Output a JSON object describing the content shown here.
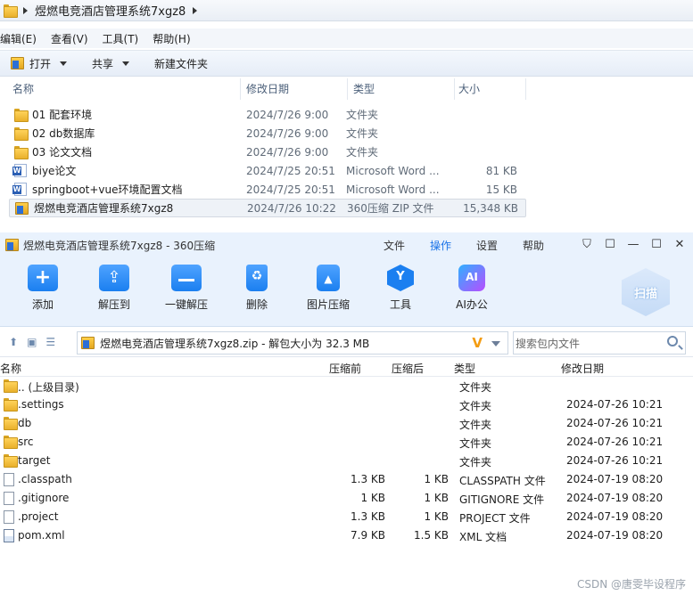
{
  "explorer": {
    "breadcrumb": "煜燃电竞酒店管理系统7xgz8",
    "menus": [
      "编辑(E)",
      "查看(V)",
      "工具(T)",
      "帮助(H)"
    ],
    "commands": {
      "open": "打开",
      "share": "共享",
      "new_folder": "新建文件夹"
    },
    "columns": {
      "name": "名称",
      "date": "修改日期",
      "type": "类型",
      "size": "大小"
    },
    "rows": [
      {
        "name": "01 配套环境",
        "date": "2024/7/26 9:00",
        "type": "文件夹",
        "size": "",
        "icon": "folder-icon"
      },
      {
        "name": "02 db数据库",
        "date": "2024/7/26 9:00",
        "type": "文件夹",
        "size": "",
        "icon": "folder-icon"
      },
      {
        "name": "03 论文文档",
        "date": "2024/7/26 9:00",
        "type": "文件夹",
        "size": "",
        "icon": "folder-icon"
      },
      {
        "name": "biye论文",
        "date": "2024/7/25 20:51",
        "type": "Microsoft Word ...",
        "size": "81 KB",
        "icon": "word-icon"
      },
      {
        "name": "springboot+vue环境配置文档",
        "date": "2024/7/25 20:51",
        "type": "Microsoft Word ...",
        "size": "15 KB",
        "icon": "word-icon"
      },
      {
        "name": "煜燃电竞酒店管理系统7xgz8",
        "date": "2024/7/26 10:22",
        "type": "360压缩 ZIP 文件",
        "size": "15,348 KB",
        "icon": "zip-icon"
      }
    ]
  },
  "zip": {
    "title": "煜燃电竞酒店管理系统7xgz8 - 360压缩",
    "menus": [
      {
        "label": "文件"
      },
      {
        "label": "操作",
        "active": true
      },
      {
        "label": "设置"
      },
      {
        "label": "帮助"
      }
    ],
    "tools": {
      "add": "添加",
      "extract_to": "解压到",
      "one_click": "一键解压",
      "delete": "删除",
      "image_compress": "图片压缩",
      "tools": "工具",
      "ai_office": "AI办公",
      "scan": "扫描"
    },
    "path": "煜燃电竞酒店管理系统7xgz8.zip - 解包大小为 32.3 MB",
    "search_placeholder": "搜索包内文件",
    "columns": {
      "name": "名称",
      "before": "压缩前",
      "after": "压缩后",
      "type": "类型",
      "date": "修改日期"
    },
    "rows": [
      {
        "name": ".. (上级目录)",
        "before": "",
        "after": "",
        "type": "文件夹",
        "date": "",
        "icon": "folder-icon"
      },
      {
        "name": ".settings",
        "before": "",
        "after": "",
        "type": "文件夹",
        "date": "2024-07-26 10:21",
        "icon": "folder-icon"
      },
      {
        "name": "db",
        "before": "",
        "after": "",
        "type": "文件夹",
        "date": "2024-07-26 10:21",
        "icon": "folder-icon"
      },
      {
        "name": "src",
        "before": "",
        "after": "",
        "type": "文件夹",
        "date": "2024-07-26 10:21",
        "icon": "folder-icon"
      },
      {
        "name": "target",
        "before": "",
        "after": "",
        "type": "文件夹",
        "date": "2024-07-26 10:21",
        "icon": "folder-icon"
      },
      {
        "name": ".classpath",
        "before": "1.3 KB",
        "after": "1 KB",
        "type": "CLASSPATH 文件",
        "date": "2024-07-19 08:20",
        "icon": "file-icon"
      },
      {
        "name": ".gitignore",
        "before": "1 KB",
        "after": "1 KB",
        "type": "GITIGNORE 文件",
        "date": "2024-07-19 08:20",
        "icon": "file-icon"
      },
      {
        "name": ".project",
        "before": "1.3 KB",
        "after": "1 KB",
        "type": "PROJECT 文件",
        "date": "2024-07-19 08:20",
        "icon": "file-icon"
      },
      {
        "name": "pom.xml",
        "before": "7.9 KB",
        "after": "1.5 KB",
        "type": "XML 文档",
        "date": "2024-07-19 08:20",
        "icon": "xml-file-icon"
      }
    ]
  },
  "watermark": "CSDN @唐雯毕设程序"
}
